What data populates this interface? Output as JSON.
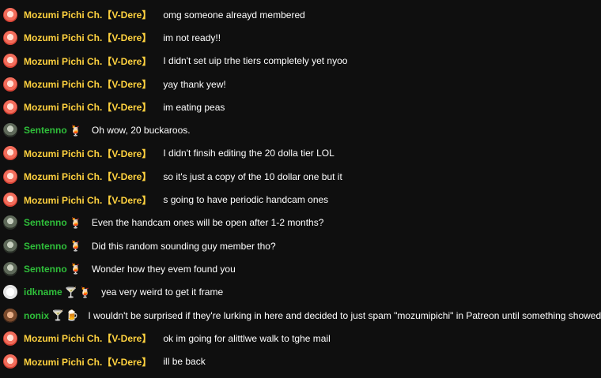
{
  "messages": [
    {
      "author": "Mozumi Pichi Ch.【V-Dere】",
      "type": "mozumi",
      "badges": [],
      "text": "omg someone alreayd membered"
    },
    {
      "author": "Mozumi Pichi Ch.【V-Dere】",
      "type": "mozumi",
      "badges": [],
      "text": "im not ready!!"
    },
    {
      "author": "Mozumi Pichi Ch.【V-Dere】",
      "type": "mozumi",
      "badges": [],
      "text": "I didn't set uip trhe tiers completely yet nyoo"
    },
    {
      "author": "Mozumi Pichi Ch.【V-Dere】",
      "type": "mozumi",
      "badges": [],
      "text": "yay thank yew!"
    },
    {
      "author": "Mozumi Pichi Ch.【V-Dere】",
      "type": "mozumi",
      "badges": [],
      "text": "im eating peas"
    },
    {
      "author": "Sentenno",
      "type": "sentenno",
      "badges": [
        "🍹"
      ],
      "text": "Oh wow, 20 buckaroos."
    },
    {
      "author": "Mozumi Pichi Ch.【V-Dere】",
      "type": "mozumi",
      "badges": [],
      "text": "I didn't finsih editing the 20 dolla tier LOL"
    },
    {
      "author": "Mozumi Pichi Ch.【V-Dere】",
      "type": "mozumi",
      "badges": [],
      "text": "so it's just a copy of the 10 dollar one but it"
    },
    {
      "author": "Mozumi Pichi Ch.【V-Dere】",
      "type": "mozumi",
      "badges": [],
      "text": "s going to have periodic handcam ones"
    },
    {
      "author": "Sentenno",
      "type": "sentenno",
      "badges": [
        "🍹"
      ],
      "text": "Even the handcam ones will be open after 1-2 months?"
    },
    {
      "author": "Sentenno",
      "type": "sentenno",
      "badges": [
        "🍹"
      ],
      "text": "Did this random sounding guy member tho?"
    },
    {
      "author": "Sentenno",
      "type": "sentenno",
      "badges": [
        "🍹"
      ],
      "text": "Wonder how they evem found you"
    },
    {
      "author": "idkname",
      "type": "idkname",
      "badges": [
        "🍸",
        "🍹"
      ],
      "text": "yea very weird to get it frame"
    },
    {
      "author": "nonix",
      "type": "nonix",
      "badges": [
        "🍸",
        "🍺"
      ],
      "text": "I wouldn't be surprised if they're lurking in here and decided to just spam \"mozumipichi\" in Patreon until something showed up."
    },
    {
      "author": "Mozumi Pichi Ch.【V-Dere】",
      "type": "mozumi",
      "badges": [],
      "text": "ok im going for alittlwe walk to tghe mail"
    },
    {
      "author": "Mozumi Pichi Ch.【V-Dere】",
      "type": "mozumi",
      "badges": [],
      "text": "ill be back"
    }
  ]
}
